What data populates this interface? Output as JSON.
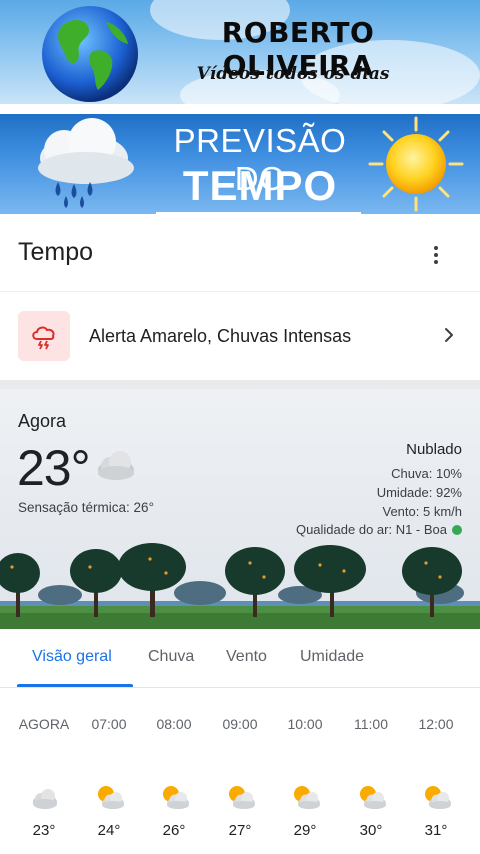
{
  "channel": {
    "name": "ROBERTO OLIVEIRA",
    "tagline": "Vídeos todos os dias"
  },
  "forecast_banner": {
    "line1": "PREVISÃO DO",
    "line2": "TEMPO"
  },
  "app": {
    "title": "Tempo",
    "menu_icon": "more-vert-icon"
  },
  "alert": {
    "icon": "storm-alert-icon",
    "text": "Alerta Amarelo, Chuvas Intensas",
    "icon_bg": "#fde3e3",
    "icon_color": "#d93025"
  },
  "current": {
    "label": "Agora",
    "temperature": "23°",
    "feels_like": "Sensação térmica: 26°",
    "condition": "Nublado",
    "rain": "Chuva: 10%",
    "humidity": "Umidade: 92%",
    "wind": "Vento: 5 km/h",
    "air_quality": "Qualidade do ar: N1 - Boa",
    "air_quality_color": "#34a853"
  },
  "tabs": [
    {
      "label": "Visão geral",
      "active": true
    },
    {
      "label": "Chuva",
      "active": false
    },
    {
      "label": "Vento",
      "active": false
    },
    {
      "label": "Umidade",
      "active": false
    }
  ],
  "hourly": [
    {
      "time": "AGORA",
      "temp": "23°",
      "icon": "cloudy-icon"
    },
    {
      "time": "07:00",
      "temp": "24°",
      "icon": "partly-cloudy-icon"
    },
    {
      "time": "08:00",
      "temp": "26°",
      "icon": "partly-cloudy-icon"
    },
    {
      "time": "09:00",
      "temp": "27°",
      "icon": "partly-cloudy-icon"
    },
    {
      "time": "10:00",
      "temp": "29°",
      "icon": "partly-cloudy-icon"
    },
    {
      "time": "11:00",
      "temp": "30°",
      "icon": "partly-cloudy-icon"
    },
    {
      "time": "12:00",
      "temp": "31°",
      "icon": "partly-cloudy-icon"
    }
  ],
  "colors": {
    "accent": "#1a73e8",
    "sun": "#f9ab00",
    "cloud": "#dadce0"
  }
}
